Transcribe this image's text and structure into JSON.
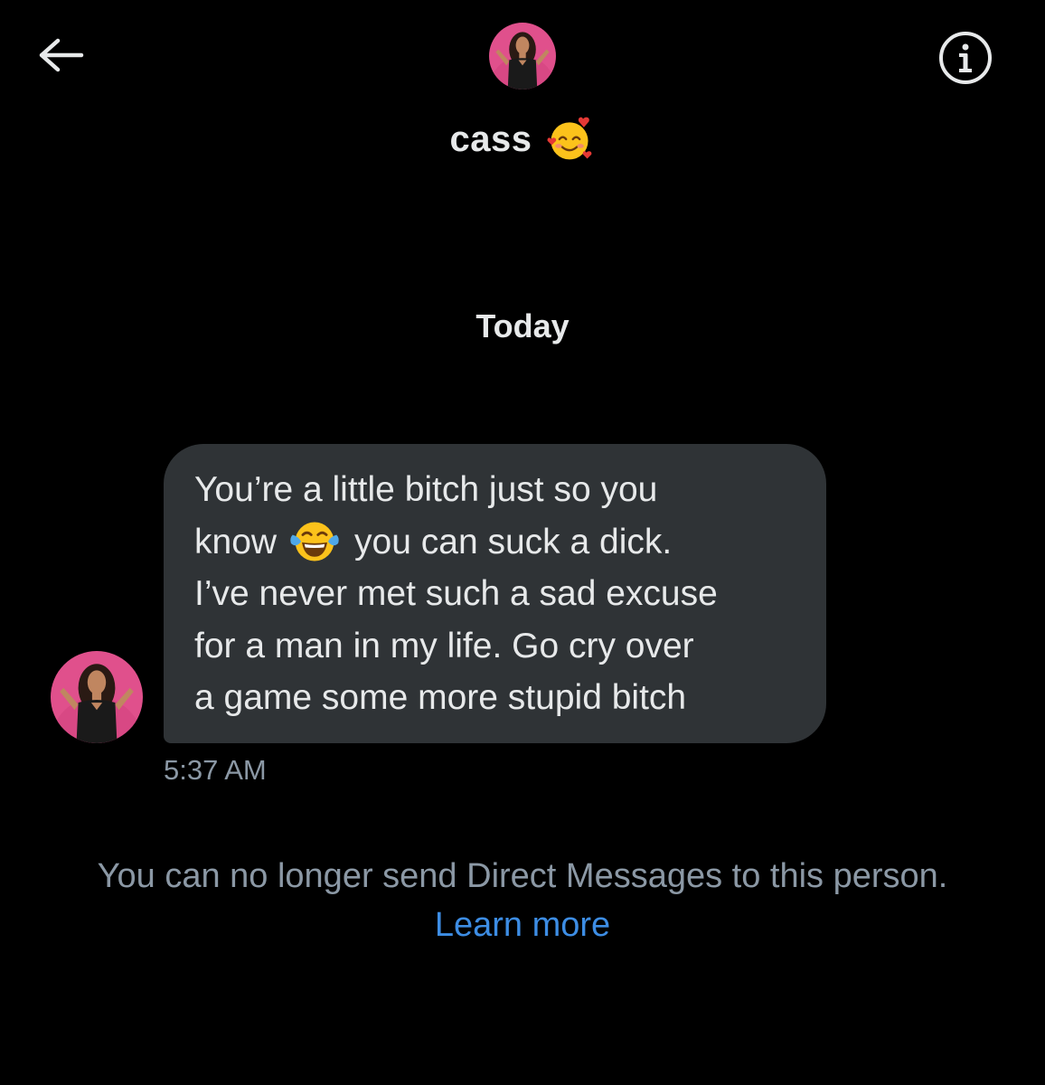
{
  "header": {
    "name": "cass",
    "name_emoji_icon": "smiling-face-with-hearts-icon",
    "avatar_icon": "profile-photo-avatar",
    "back_icon": "arrow-left-icon",
    "info_icon": "info-icon"
  },
  "conversation": {
    "date_separator": "Today",
    "messages": [
      {
        "sender": "cass",
        "lines": [
          "You’re a little bitch just so you",
          "know",
          "you can suck a dick.",
          "I’ve never met such a sad excuse",
          "for a man in my life. Go cry over",
          "a game some more stupid bitch"
        ],
        "inline_emoji_icon": "face-with-tears-of-joy-icon",
        "timestamp": "5:37 AM"
      }
    ]
  },
  "footer": {
    "notice": "You can no longer send Direct Messages to this person.",
    "link": "Learn more"
  },
  "colors": {
    "background": "#000000",
    "bubble": "#2f3336",
    "text": "#e7e9ea",
    "muted": "#8b98a5",
    "link": "#3d8de4",
    "avatar_bg": "#e0508c"
  }
}
